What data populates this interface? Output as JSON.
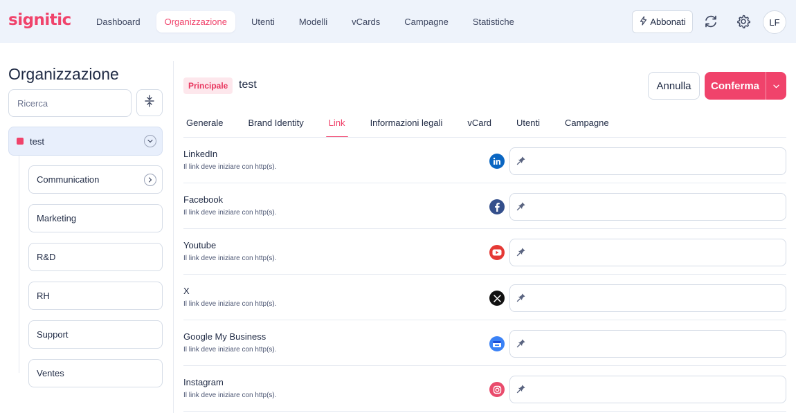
{
  "brand": {
    "logo_text": "signitic",
    "accent_color": "#f0436b"
  },
  "nav": {
    "items": [
      {
        "label": "Dashboard",
        "active": false
      },
      {
        "label": "Organizzazione",
        "active": true
      },
      {
        "label": "Utenti",
        "active": false
      },
      {
        "label": "Modelli",
        "active": false
      },
      {
        "label": "vCards",
        "active": false
      },
      {
        "label": "Campagne",
        "active": false
      },
      {
        "label": "Statistiche",
        "active": false
      }
    ],
    "subscribe_label": "Abbonati",
    "avatar_initials": "LF",
    "icons": [
      "lightning-icon",
      "sync-icon",
      "gear-icon"
    ]
  },
  "sidebar": {
    "title": "Organizzazione",
    "search_placeholder": "Ricerca",
    "root": {
      "label": "test",
      "color": "#f0436b"
    },
    "children": [
      {
        "label": "Communication",
        "has_children": true
      },
      {
        "label": "Marketing",
        "has_children": false
      },
      {
        "label": "R&D",
        "has_children": false
      },
      {
        "label": "RH",
        "has_children": false
      },
      {
        "label": "Support",
        "has_children": false
      },
      {
        "label": "Ventes",
        "has_children": false
      }
    ]
  },
  "header": {
    "badge": "Principale",
    "org_name": "test",
    "cancel_label": "Annulla",
    "confirm_label": "Conferma"
  },
  "tabs": [
    {
      "label": "Generale",
      "active": false
    },
    {
      "label": "Brand Identity",
      "active": false
    },
    {
      "label": "Link",
      "active": true
    },
    {
      "label": "Informazioni legali",
      "active": false
    },
    {
      "label": "vCard",
      "active": false
    },
    {
      "label": "Utenti",
      "active": false
    },
    {
      "label": "Campagne",
      "active": false
    }
  ],
  "links": [
    {
      "label": "LinkedIn",
      "help": "Il link deve iniziare con http(s).",
      "icon": "linkedin-icon",
      "icon_color": "#0a66c2",
      "value": ""
    },
    {
      "label": "Facebook",
      "help": "Il link deve iniziare con http(s).",
      "icon": "facebook-icon",
      "icon_color": "#344f8c",
      "value": ""
    },
    {
      "label": "Youtube",
      "help": "Il link deve iniziare con http(s).",
      "icon": "youtube-icon",
      "icon_color": "#e53935",
      "value": ""
    },
    {
      "label": "X",
      "help": "Il link deve iniziare con http(s).",
      "icon": "x-icon",
      "icon_color": "#111111",
      "value": ""
    },
    {
      "label": "Google My Business",
      "help": "Il link deve iniziare con http(s).",
      "icon": "google-my-business-icon",
      "icon_color": "#3b82f6",
      "value": ""
    },
    {
      "label": "Instagram",
      "help": "Il link deve iniziare con http(s).",
      "icon": "instagram-icon",
      "icon_color": "#e94b6c",
      "value": ""
    }
  ]
}
